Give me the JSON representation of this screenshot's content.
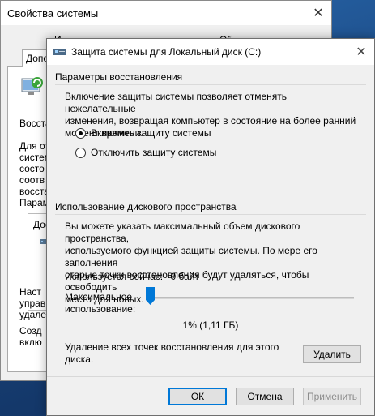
{
  "background_window": {
    "title": "Свойства системы",
    "tab_row1": [
      "И",
      "Об"
    ],
    "tab_active": "Допо",
    "left_texts": [
      "Восста",
      "Для от",
      "систем",
      "состо",
      "соотв",
      "восста",
      "Парам",
      "Дос",
      "Наст",
      "управ",
      "удале",
      "Созд",
      "вклю"
    ]
  },
  "dialog": {
    "title": "Защита системы для Локальный диск (C:)",
    "restore_section": {
      "heading": "Параметры восстановления",
      "description_lines": [
        "Включение защиты системы позволяет отменять нежелательные",
        "изменения, возвращая компьютер в состояние на более ранний",
        "момент времени."
      ],
      "options": [
        {
          "label": "Включить защиту системы",
          "checked": true
        },
        {
          "label": "Отключить защиту системы",
          "checked": false
        }
      ]
    },
    "disk_section": {
      "heading": "Использование дискового пространства",
      "description_lines": [
        "Вы можете указать максимальный объем дискового пространства,",
        "используемого функцией защиты системы. По мере его заполнения",
        "старые точки восстановления будут удаляться, чтобы освободить",
        "место для новых."
      ],
      "current_usage_label": "Используется сейчас:",
      "current_usage_value": "0 байт",
      "max_usage_label_line1": "Максимальное",
      "max_usage_label_line2": "использование:",
      "max_usage_fraction": 0.01,
      "max_usage_readout": "1% (1,11 ГБ)",
      "delete_text_line1": "Удаление всех точек восстановления для этого",
      "delete_text_line2": "диска.",
      "delete_button": "Удалить"
    },
    "footer": {
      "ok": "ОК",
      "cancel": "Отмена",
      "apply": "Применить"
    }
  },
  "colors": {
    "accent": "#0078d7",
    "slider_thumb": "#0078d7"
  }
}
